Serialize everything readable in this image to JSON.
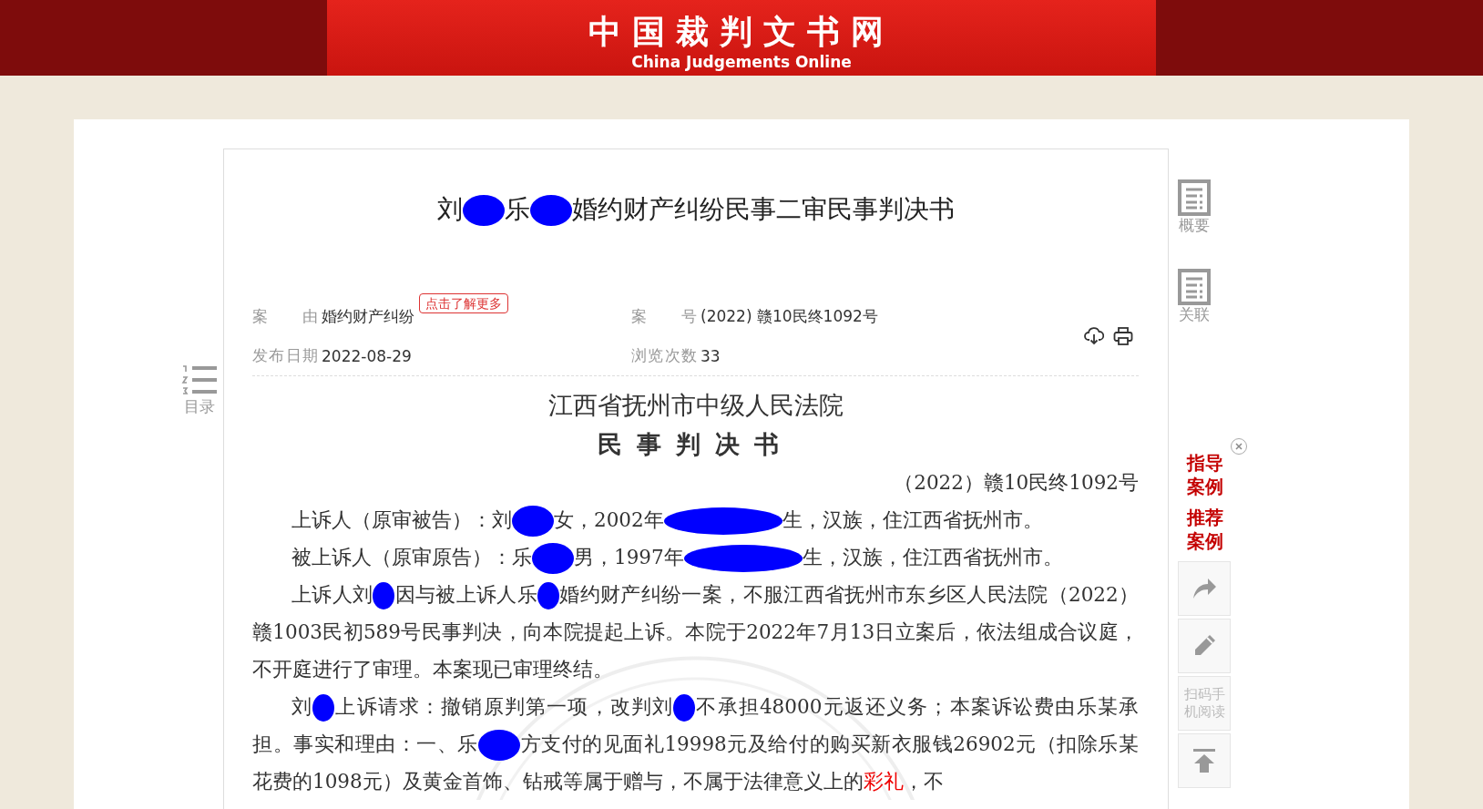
{
  "header": {
    "title": "中国裁判文书网",
    "subtitle": "China Judgements Online"
  },
  "toc": {
    "label": "目录"
  },
  "document": {
    "title": [
      {
        "kind": "text",
        "text": "刘"
      },
      {
        "kind": "redacted"
      },
      {
        "kind": "text",
        "text": "乐"
      },
      {
        "kind": "redacted"
      },
      {
        "kind": "text",
        "text": "婚约财产纠纷民事二审民事判决书"
      }
    ],
    "meta": [
      {
        "label": "案 由",
        "value": "婚约财产纠纷",
        "badge": "点击了解更多"
      },
      {
        "label": "案 号",
        "value": "(2022) 赣10民终1092号"
      },
      {
        "label": "发布日期",
        "value": "2022-08-29"
      },
      {
        "label": "浏览次数",
        "value": "33"
      }
    ],
    "court": "江西省抚州市中级人民法院",
    "doc_type": "民事判决书",
    "case_number": "（2022）赣10民终1092号",
    "paragraphs": [
      [
        {
          "kind": "text",
          "text": "上诉人（原审被告）：刘"
        },
        {
          "kind": "redacted"
        },
        {
          "kind": "text",
          "text": "女，2002年"
        },
        {
          "kind": "redacted_wide"
        },
        {
          "kind": "text",
          "text": "生，汉族，住江西省抚州市。"
        }
      ],
      [
        {
          "kind": "text",
          "text": "被上诉人（原审原告）：乐"
        },
        {
          "kind": "redacted"
        },
        {
          "kind": "text",
          "text": "男，1997年"
        },
        {
          "kind": "redacted_wide"
        },
        {
          "kind": "text",
          "text": "生，汉族，住江西省抚州市。"
        }
      ],
      [
        {
          "kind": "text",
          "text": "上诉人刘"
        },
        {
          "kind": "redacted_small"
        },
        {
          "kind": "text",
          "text": "因与被上诉人乐"
        },
        {
          "kind": "redacted_small"
        },
        {
          "kind": "text",
          "text": "婚约财产纠纷一案，不服江西省抚州市东乡区人民法院（2022）赣1003民初589号民事判决，向本院提起上诉。本院于2022年7月13日立案后，依法组成合议庭，不开庭进行了审理。本案现已审理终结。"
        }
      ],
      [
        {
          "kind": "text",
          "text": "刘"
        },
        {
          "kind": "redacted_small"
        },
        {
          "kind": "text",
          "text": "上诉请求：撤销原判第一项，改判刘"
        },
        {
          "kind": "redacted_small"
        },
        {
          "kind": "text",
          "text": "不承担48000元返还义务；本案诉讼费由乐某承担。事实和理由：一、乐"
        },
        {
          "kind": "redacted"
        },
        {
          "kind": "text",
          "text": "方支付的见面礼19998元及给付的购买新衣服钱26902元（扣除乐某花费的1098元）及黄金首饰、钻戒等属于赠与，不属于法律意义上的"
        },
        {
          "kind": "highlight",
          "text": "彩礼"
        },
        {
          "kind": "text",
          "text": "，不"
        }
      ]
    ]
  },
  "side_nav": [
    {
      "label": "概要"
    },
    {
      "label": "关联"
    }
  ],
  "case_links": [
    {
      "label": "指导案例"
    },
    {
      "label": "推荐案例"
    }
  ],
  "tools": [
    {
      "kind": "share"
    },
    {
      "kind": "edit"
    },
    {
      "kind": "qr",
      "label": "扫码手机阅读"
    },
    {
      "kind": "top"
    }
  ]
}
